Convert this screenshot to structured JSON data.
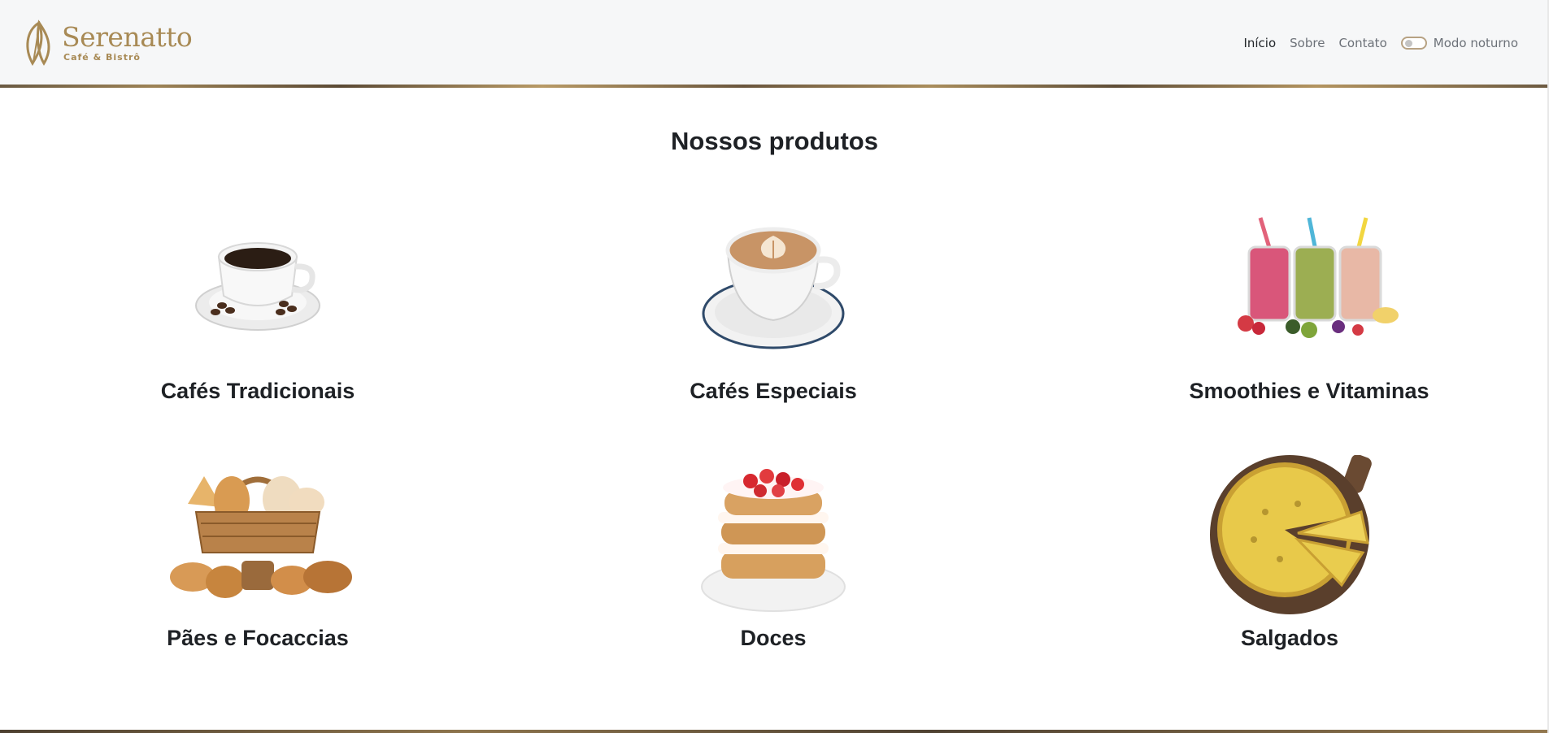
{
  "brand": {
    "name": "Serenatto",
    "subtitle": "Café & Bistrô",
    "color": "#a88a55"
  },
  "nav": {
    "items": [
      {
        "label": "Início",
        "active": true
      },
      {
        "label": "Sobre",
        "active": false
      },
      {
        "label": "Contato",
        "active": false
      }
    ],
    "theme_toggle": {
      "label": "Modo noturno",
      "on": false
    }
  },
  "main": {
    "title": "Nossos produtos",
    "products": [
      {
        "name": "Cafés Tradicionais",
        "icon": "coffee-cup-image"
      },
      {
        "name": "Cafés Especiais",
        "icon": "latte-art-image"
      },
      {
        "name": "Smoothies e Vitaminas",
        "icon": "smoothie-jars-image"
      },
      {
        "name": "Pães e Focaccias",
        "icon": "bread-basket-image"
      },
      {
        "name": "Doces",
        "icon": "strawberry-cake-image"
      },
      {
        "name": "Salgados",
        "icon": "quiche-image"
      }
    ]
  }
}
